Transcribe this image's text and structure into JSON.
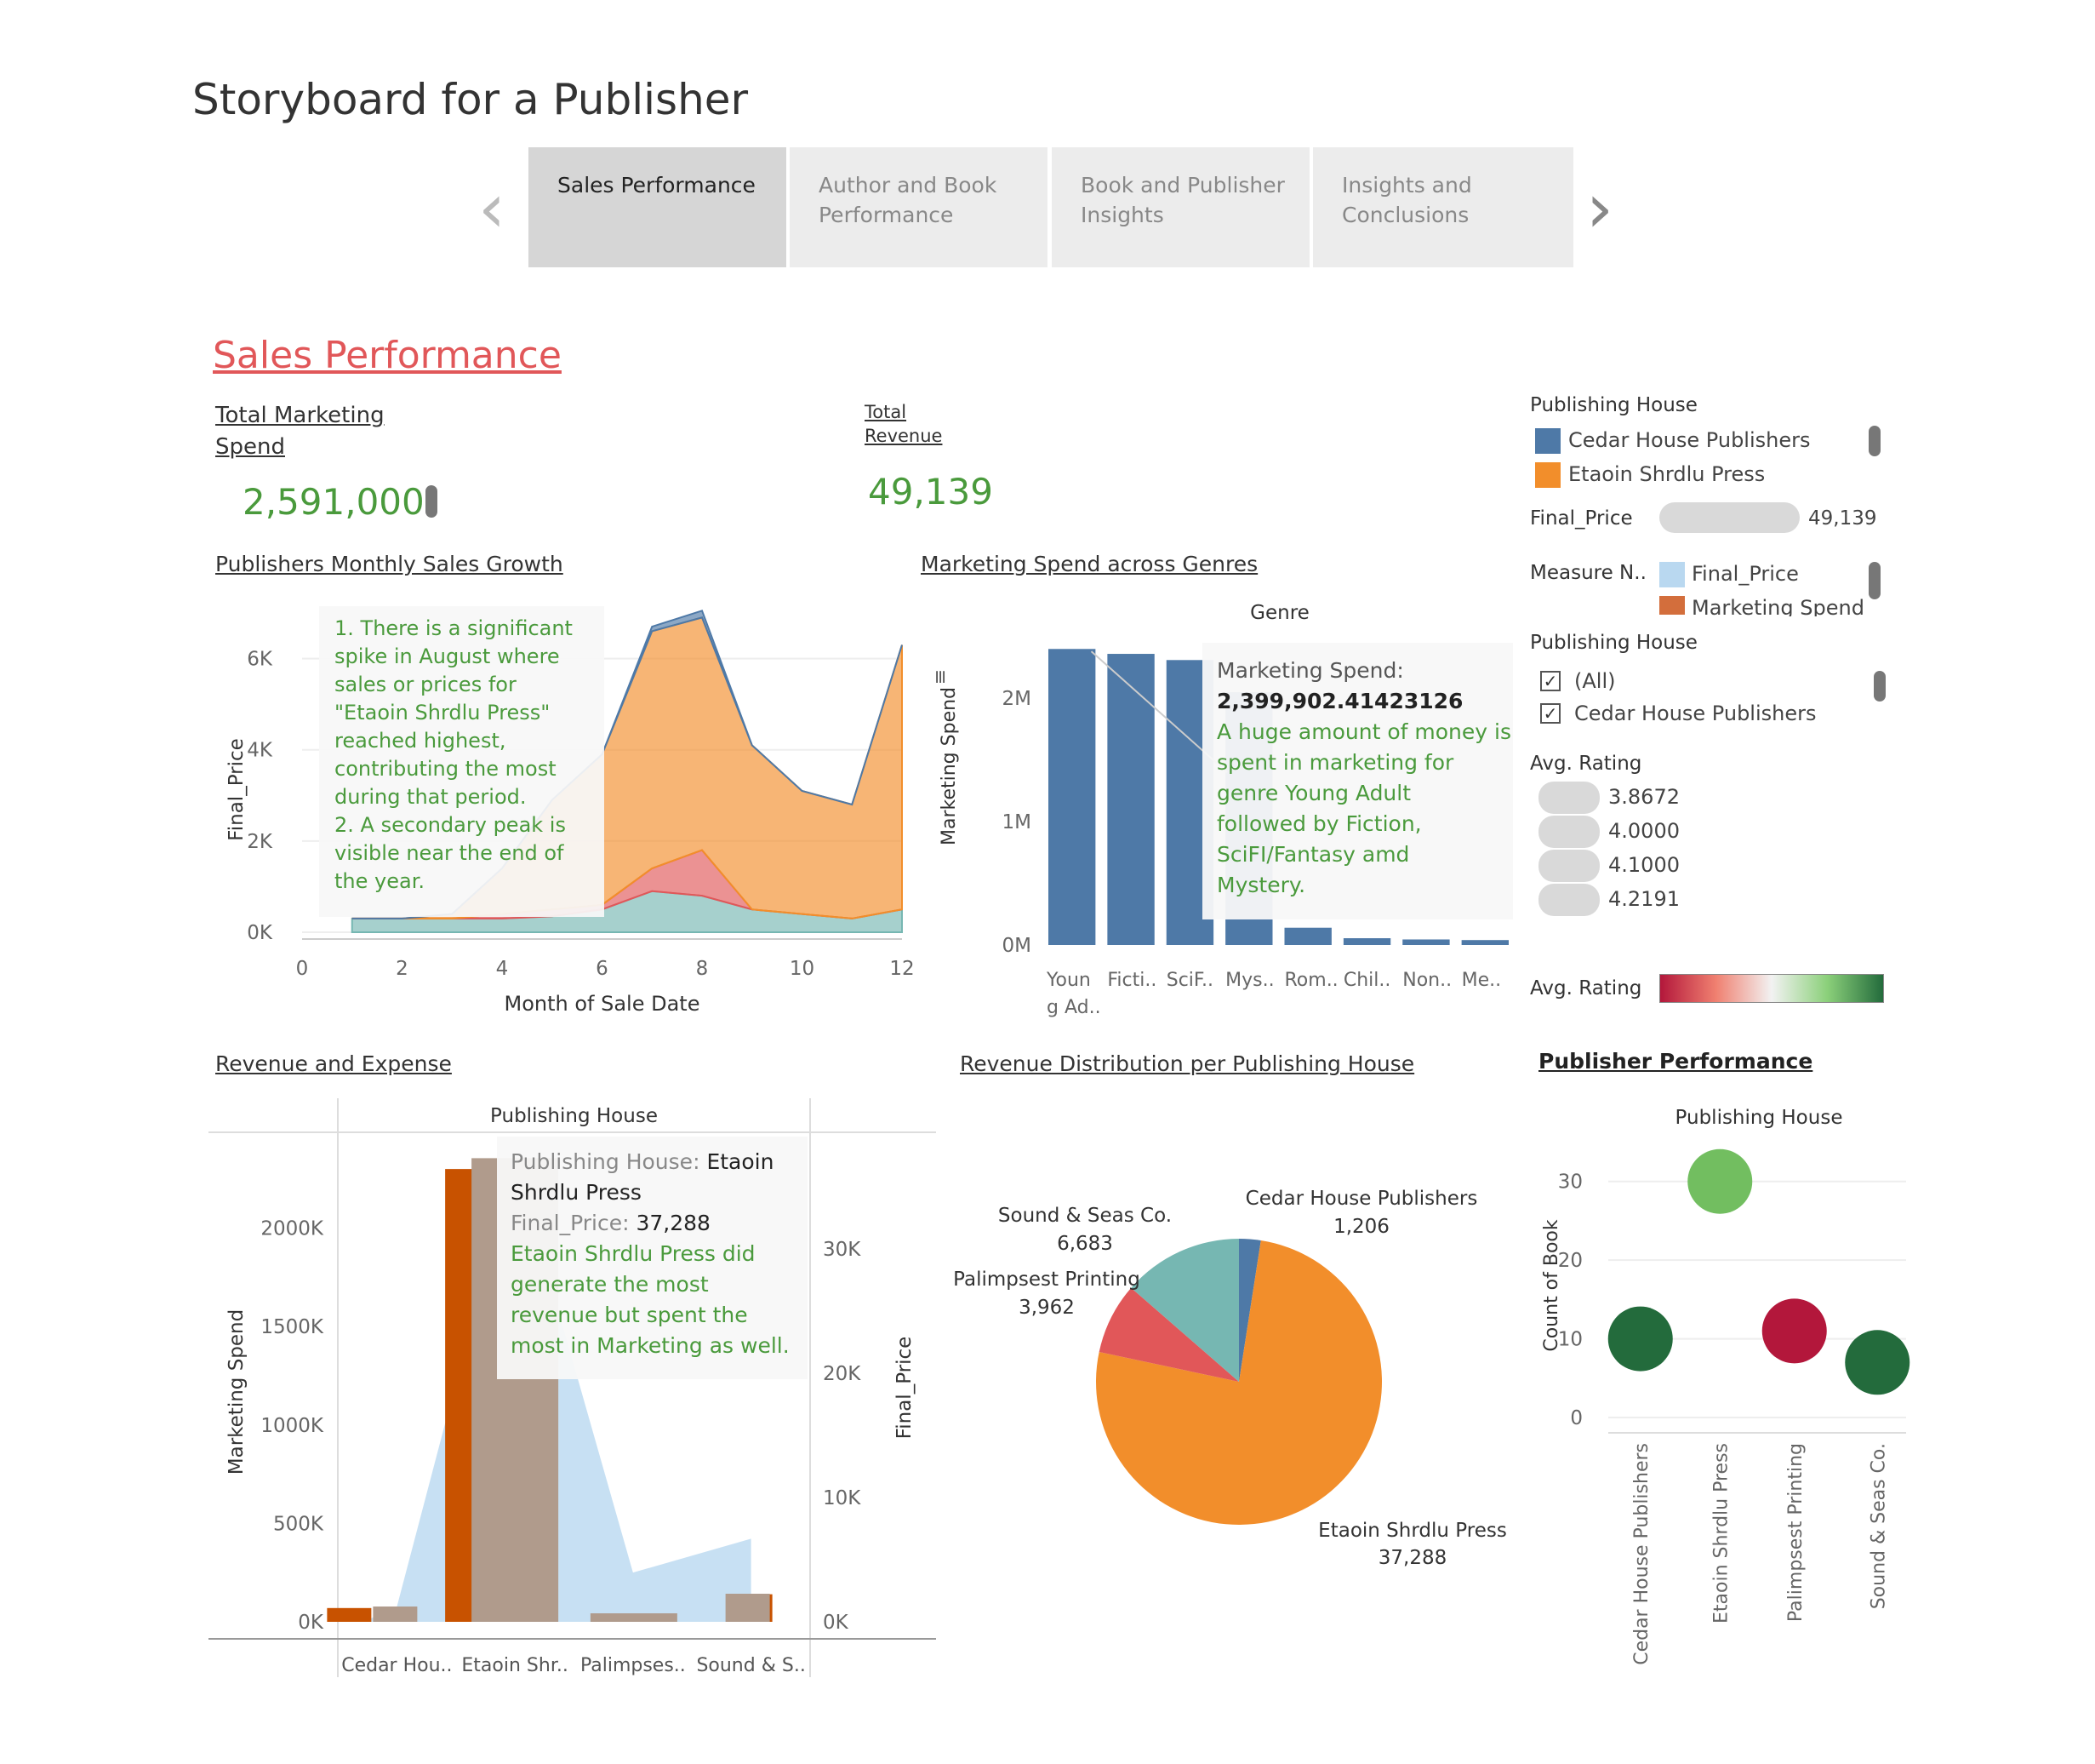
{
  "page_title": "Storyboard for a Publisher",
  "nav": {
    "prev": "‹",
    "next": "›",
    "tabs": [
      {
        "line1": "Sales Performance",
        "line2": ""
      },
      {
        "line1": "Author and Book",
        "line2": "Performance"
      },
      {
        "line1": "Book and Publisher",
        "line2": "Insights"
      },
      {
        "line1": "Insights and",
        "line2": "Conclusions"
      }
    ]
  },
  "section_title": "Sales Performance",
  "kpi": {
    "marketing": {
      "label1": "Total Marketing",
      "label2": "Spend",
      "value": "2,591,000"
    },
    "revenue": {
      "label1": "Total",
      "label2": "Revenue",
      "value": "49,139"
    }
  },
  "colors": {
    "blue": "#4e79a7",
    "orange": "#f28e2b",
    "red": "#e15759",
    "teal": "#76b7b2",
    "green_text": "#4a9a3c",
    "dark_orange": "#c85200",
    "taupe": "#b09b8c",
    "light_blue": "#b9d8f0"
  },
  "sidebar": {
    "legend1_title": "Publishing House",
    "legend1_items": [
      "Cedar House Publishers",
      "Etaoin Shrdlu Press"
    ],
    "final_price_label": "Final_Price",
    "final_price_value": "49,139",
    "measure_label": "Measure N..",
    "measure_items": [
      "Final_Price",
      "Marketing Spend"
    ],
    "filter_title": "Publishing House",
    "filter_items": [
      "(All)",
      "Cedar House Publishers"
    ],
    "rating_title": "Avg. Rating",
    "rating_items": [
      "3.8672",
      "4.0000",
      "4.1000",
      "4.2191"
    ],
    "rating_gradient_label": "Avg. Rating"
  },
  "chart1": {
    "title": "Publishers Monthly Sales Growth",
    "annotation": [
      "1. There is a significant",
      "spike in August where",
      "sales or prices for",
      "\"Etaoin Shrdlu Press\"",
      "reached  highest,",
      "contributing the most",
      "during that period.",
      "2. A secondary peak is",
      "visible near the end of",
      "the year."
    ]
  },
  "chart2": {
    "title": "Marketing Spend across Genres",
    "tooltip_label": "Marketing Spend:",
    "tooltip_value": "2,399,902.41423126",
    "tooltip_text": [
      "A huge amount of money is",
      "spent in marketing for",
      "genre Young Adult",
      "followed by Fiction,",
      "SciFI/Fantasy amd",
      "Mystery."
    ]
  },
  "chart3": {
    "title": "Revenue and Expense",
    "tooltip_key1": "Publishing House: ",
    "tooltip_val1a": "Etaoin",
    "tooltip_val1b": "Shrdlu Press",
    "tooltip_key2": "Final_Price: ",
    "tooltip_val2": "37,288",
    "tooltip_text": [
      "Etaoin Shrdlu Press did",
      "generate the most",
      "revenue but spent the",
      "most in Marketing as well."
    ]
  },
  "chart4": {
    "title": "Revenue Distribution per Publishing House"
  },
  "chart5": {
    "title": "Publisher Performance"
  },
  "chart_data": [
    {
      "type": "area",
      "title": "",
      "xlabel": "Month of Sale Date",
      "ylabel": "Final_Price",
      "xlim": [
        0,
        12
      ],
      "ylim": [
        0,
        7000
      ],
      "x_ticks": [
        "0",
        "2",
        "4",
        "6",
        "8",
        "10",
        "12"
      ],
      "y_ticks": [
        "0K",
        "2K",
        "4K",
        "6K"
      ],
      "x": [
        1,
        2,
        3,
        4,
        5,
        6,
        7,
        8,
        9,
        10,
        11,
        12
      ],
      "series": [
        {
          "name": "",
          "color": "#76b7b2",
          "values": [
            300,
            300,
            300,
            300,
            350,
            500,
            900,
            800,
            500,
            400,
            300,
            500
          ]
        },
        {
          "name": "",
          "color": "#e15759",
          "values": [
            0,
            0,
            0,
            100,
            150,
            100,
            500,
            1000,
            0,
            0,
            0,
            0
          ]
        },
        {
          "name": "",
          "color": "#f28e2b",
          "values": [
            0,
            0,
            100,
            1000,
            2400,
            3300,
            5200,
            5100,
            3600,
            2700,
            2500,
            5800
          ]
        },
        {
          "name": "",
          "color": "#4e79a7",
          "values": [
            0,
            0,
            0,
            0,
            0,
            0,
            100,
            150,
            0,
            0,
            0,
            0
          ]
        }
      ]
    },
    {
      "type": "bar",
      "title": "Genre",
      "ylabel": "Marketing Spend",
      "categories": [
        "Youn g Ad..",
        "Ficti..",
        "SciF..",
        "Mys..",
        "Rom..",
        "Chil..",
        "Non..",
        "Me.."
      ],
      "values": [
        2399902,
        2360000,
        2310000,
        2050000,
        140000,
        55000,
        45000,
        40000
      ],
      "ylim": [
        0,
        2450000
      ],
      "y_ticks": [
        "0M",
        "1M",
        "2M"
      ],
      "color": "#4e79a7"
    },
    {
      "type": "bar",
      "title": "Publishing House",
      "ylabel_left": "Marketing Spend",
      "ylabel_right": "Final_Price",
      "categories": [
        "Cedar Hou..",
        "Etaoin Shr..",
        "Palimpses..",
        "Sound & S.."
      ],
      "left_ticks": [
        "0K",
        "500K",
        "1000K",
        "1500K",
        "2000K"
      ],
      "right_ticks": [
        "0K",
        "10K",
        "20K",
        "30K"
      ],
      "marketing_spend": [
        70000,
        2300000,
        0,
        140000
      ],
      "final_price": [
        1206,
        37288,
        3962,
        6683
      ]
    },
    {
      "type": "pie",
      "labels": [
        "Cedar House Publishers",
        "Etaoin Shrdlu Press",
        "Palimpsest Printing",
        "Sound & Seas Co."
      ],
      "values": [
        1206,
        37288,
        3962,
        6683
      ],
      "value_labels": [
        "1,206",
        "37,288",
        "3,962",
        "6,683"
      ],
      "colors": [
        "#4e79a7",
        "#f28e2b",
        "#e15759",
        "#76b7b2"
      ]
    },
    {
      "type": "scatter",
      "title": "Publishing House",
      "ylabel": "Count of Book",
      "categories": [
        "Cedar House Publishers",
        "Etaoin Shrdlu Press",
        "Palimpsest Printing",
        "Sound & Seas Co."
      ],
      "values": [
        10,
        30,
        11,
        7
      ],
      "colors": [
        "#236b3c",
        "#72be60",
        "#b3173b",
        "#236b3c"
      ],
      "ylim": [
        0,
        33
      ],
      "y_ticks": [
        "0",
        "10",
        "20",
        "30"
      ]
    }
  ]
}
